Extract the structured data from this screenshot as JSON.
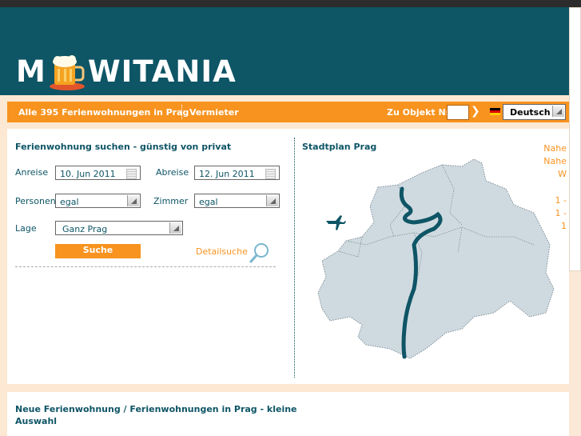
{
  "header": {
    "logo_text_left": "M",
    "logo_text_right": "WITANIA"
  },
  "nav": {
    "all_apartments": "Alle 395 Ferienwohnungen in Prag",
    "landlord": "Vermieter",
    "object_no_label": "Zu Objekt Nr",
    "object_no_value": "",
    "language": "Deutsch"
  },
  "search": {
    "title": "Ferienwohnung suchen - günstig von privat",
    "arrival_label": "Anreise",
    "arrival_value": "10. Jun 2011",
    "departure_label": "Abreise",
    "departure_value": "12. Jun 2011",
    "persons_label": "Personen",
    "persons_value": "egal",
    "rooms_label": "Zimmer",
    "rooms_value": "egal",
    "location_label": "Lage",
    "location_value": "Ganz Prag",
    "search_button": "Suche",
    "detail_search": "Detailsuche"
  },
  "map": {
    "title": "Stadtplan Prag"
  },
  "right_column": [
    "Nahe",
    "Nahe",
    "W",
    "1 -",
    "1 -",
    "1"
  ],
  "lower": {
    "title_line1": "Neue Ferienwohnung / Ferienwohnungen in Prag - kleine",
    "title_line2": "Auswahl"
  },
  "colors": {
    "accent": "#f7931e",
    "brand": "#0e5566",
    "background": "#fde8d3",
    "map_fill": "#cfdae0"
  }
}
